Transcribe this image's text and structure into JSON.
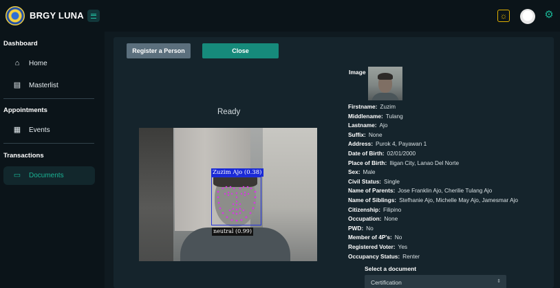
{
  "app": {
    "title": "BRGY LUNA"
  },
  "sidebar": {
    "sections": [
      {
        "label": "Dashboard",
        "items": [
          {
            "label": "Home",
            "icon": "home-icon"
          },
          {
            "label": "Masterlist",
            "icon": "clipboard-icon"
          }
        ]
      },
      {
        "label": "Appointments",
        "items": [
          {
            "label": "Events",
            "icon": "calendar-icon"
          }
        ]
      },
      {
        "label": "Transactions",
        "items": [
          {
            "label": "Documents",
            "icon": "folder-icon",
            "active": true
          }
        ]
      }
    ]
  },
  "buttons": {
    "register": "Register a Person",
    "close": "Close"
  },
  "camera": {
    "status": "Ready",
    "face_label": "Zuzim Ajo (0.38)",
    "emotion_label": "neutral (0.99)"
  },
  "details": {
    "image_label": "Image",
    "fields": [
      {
        "label": "Firstname:",
        "value": "Zuzim"
      },
      {
        "label": "Middlename:",
        "value": "Tulang"
      },
      {
        "label": "Lastname:",
        "value": "Ajo"
      },
      {
        "label": "Suffix:",
        "value": "None"
      },
      {
        "label": "Address:",
        "value": "Purok 4, Payawan 1"
      },
      {
        "label": "Date of Birth:",
        "value": "02/01/2000"
      },
      {
        "label": "Place of Birth:",
        "value": "Iligan City, Lanao Del Norte"
      },
      {
        "label": "Sex:",
        "value": "Male"
      },
      {
        "label": "Civil Status:",
        "value": "Single"
      },
      {
        "label": "Name of Parents:",
        "value": "Jose Franklin Ajo, Cherilie Tulang Ajo"
      },
      {
        "label": "Name of Siblings:",
        "value": "Stefhanie Ajo, Michelle May Ajo, Jamesmar Ajo"
      },
      {
        "label": "Citizenship:",
        "value": "Filipino"
      },
      {
        "label": "Occupation:",
        "value": "None"
      },
      {
        "label": "PWD:",
        "value": "No"
      },
      {
        "label": "Member of 4P's:",
        "value": "No"
      },
      {
        "label": "Registered Voter:",
        "value": "Yes"
      },
      {
        "label": "Occupancy Status:",
        "value": "Renter"
      }
    ]
  },
  "document_select": {
    "label": "Select a document",
    "selected": "Certification"
  },
  "colors": {
    "accent": "#1ab394",
    "sidebar_bg": "#0b1419",
    "panel_bg": "#15242c",
    "face_box": "#2233dd"
  }
}
